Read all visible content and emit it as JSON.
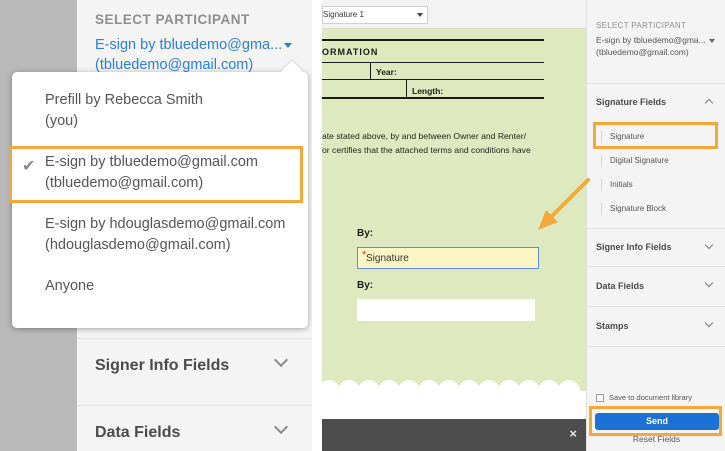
{
  "colors": {
    "accent_blue": "#2d7fd2",
    "highlight_orange": "#f3a93a",
    "send_blue": "#1c71d6",
    "document_green": "#dfe9bf",
    "signature_yellow": "#fbf5c3"
  },
  "left_panel": {
    "title": "SELECT PARTICIPANT",
    "selected_line1": "E-sign by tbluedemo@gma...",
    "selected_line2": "(tbluedemo@gmail.com)",
    "dropdown_items": [
      {
        "line1": "Prefill by Rebecca Smith",
        "line2": "(you)"
      },
      {
        "line1": "E-sign by tbluedemo@gmail.com",
        "line2": "(tbluedemo@gmail.com)",
        "checked": true
      },
      {
        "line1": "E-sign by hdouglasdemo@gmail.com",
        "line2": "(hdouglasdemo@gmail.com)"
      },
      {
        "line1": "Anyone",
        "line2": ""
      }
    ],
    "check_icon": "checkmark-icon",
    "sections": [
      {
        "label": "Signer Info Fields"
      },
      {
        "label": "Data Fields"
      }
    ]
  },
  "document": {
    "field_selector": "Signature 1",
    "heading": "ORMATION",
    "year_label": "Year:",
    "length_label": "Length:",
    "paragraph_line1": "ate stated above, by and between Owner and Renter/",
    "paragraph_line2": "or certifies that the attached terms and conditions have",
    "by_label_1": "By:",
    "by_label_2": "By:",
    "signature_field_text": "Signature",
    "required_mark": "*",
    "close_icon": "close-icon",
    "close_glyph": "×"
  },
  "right_panel": {
    "title": "SELECT PARTICIPANT",
    "selected_line1": "E-sign by tbluedemo@gma...",
    "selected_line2": "(tbluedemo@gmail.com)",
    "signature_fields_label": "Signature Fields",
    "signature_fields_items": [
      "Signature",
      "Digital Signature",
      "Initials",
      "Signature Block"
    ],
    "signer_info_label": "Signer Info Fields",
    "data_fields_label": "Data Fields",
    "stamps_label": "Stamps",
    "save_to_library": "Save to document library",
    "send_button": "Send",
    "reset_fields": "Reset Fields"
  }
}
